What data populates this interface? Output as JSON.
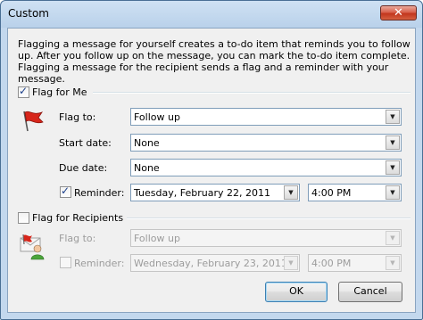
{
  "window": {
    "title": "Custom",
    "close_glyph": "✕"
  },
  "description": "Flagging a message for yourself creates a to-do item that reminds you to follow up. After you follow up on the message, you can mark the to-do item complete. Flagging a message for the recipient sends a flag and a reminder with your message.",
  "flag_for_me": {
    "checkbox_label": "Flag for Me",
    "checked": true,
    "icon": "red-flag-icon",
    "flag_to_label": "Flag to:",
    "flag_to_value": "Follow up",
    "start_date_label": "Start date:",
    "start_date_value": "None",
    "due_date_label": "Due date:",
    "due_date_value": "None",
    "reminder_label": "Reminder:",
    "reminder_checked": true,
    "reminder_date": "Tuesday, February 22, 2011",
    "reminder_time": "4:00 PM"
  },
  "flag_for_recipients": {
    "checkbox_label": "Flag for Recipients",
    "checked": false,
    "icon": "contact-flag-icon",
    "flag_to_label": "Flag to:",
    "flag_to_value": "Follow up",
    "reminder_label": "Reminder:",
    "reminder_checked": false,
    "reminder_date": "Wednesday, February 23, 2011",
    "reminder_time": "4:00 PM"
  },
  "buttons": {
    "ok": "OK",
    "cancel": "Cancel"
  },
  "colors": {
    "title_gradient": "#b9d1ea",
    "flag_red": "#d7261b",
    "accent_border": "#3c7fb1"
  }
}
